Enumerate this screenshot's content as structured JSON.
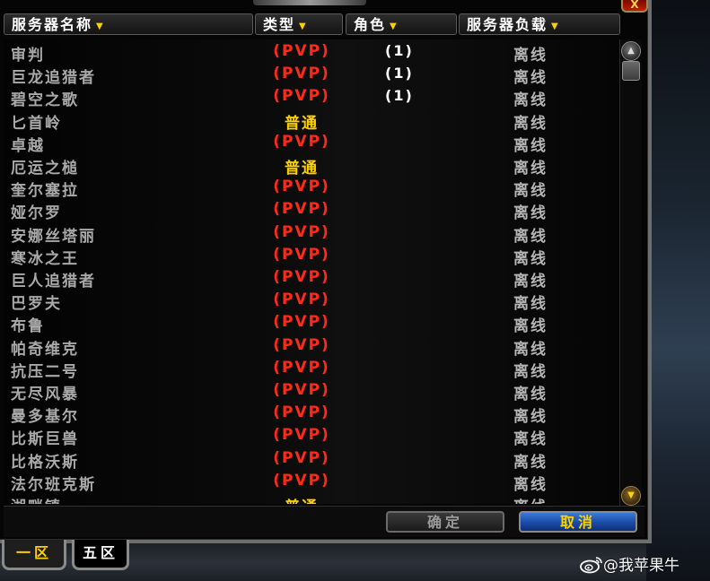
{
  "header": {
    "col_name": "服务器名称",
    "col_type": "类型",
    "col_char": "角色",
    "col_load": "服务器负载"
  },
  "colors": {
    "pvp": "#ff2a1a",
    "normal": "#ffd100",
    "accent_blue": "#1a4aa8"
  },
  "servers": [
    {
      "name": "审判",
      "type": "(PVP)",
      "type_kind": "pvp",
      "chars": "(1)",
      "load": "离线"
    },
    {
      "name": "巨龙追猎者",
      "type": "(PVP)",
      "type_kind": "pvp",
      "chars": "(1)",
      "load": "离线"
    },
    {
      "name": "碧空之歌",
      "type": "(PVP)",
      "type_kind": "pvp",
      "chars": "(1)",
      "load": "离线"
    },
    {
      "name": "匕首岭",
      "type": "普通",
      "type_kind": "normal",
      "chars": "",
      "load": "离线"
    },
    {
      "name": "卓越",
      "type": "(PVP)",
      "type_kind": "pvp",
      "chars": "",
      "load": "离线"
    },
    {
      "name": "厄运之槌",
      "type": "普通",
      "type_kind": "normal",
      "chars": "",
      "load": "离线"
    },
    {
      "name": "奎尔塞拉",
      "type": "(PVP)",
      "type_kind": "pvp",
      "chars": "",
      "load": "离线"
    },
    {
      "name": "娅尔罗",
      "type": "(PVP)",
      "type_kind": "pvp",
      "chars": "",
      "load": "离线"
    },
    {
      "name": "安娜丝塔丽",
      "type": "(PVP)",
      "type_kind": "pvp",
      "chars": "",
      "load": "离线"
    },
    {
      "name": "寒冰之王",
      "type": "(PVP)",
      "type_kind": "pvp",
      "chars": "",
      "load": "离线"
    },
    {
      "name": "巨人追猎者",
      "type": "(PVP)",
      "type_kind": "pvp",
      "chars": "",
      "load": "离线"
    },
    {
      "name": "巴罗夫",
      "type": "(PVP)",
      "type_kind": "pvp",
      "chars": "",
      "load": "离线"
    },
    {
      "name": "布鲁",
      "type": "(PVP)",
      "type_kind": "pvp",
      "chars": "",
      "load": "离线"
    },
    {
      "name": "帕奇维克",
      "type": "(PVP)",
      "type_kind": "pvp",
      "chars": "",
      "load": "离线"
    },
    {
      "name": "抗压二号",
      "type": "(PVP)",
      "type_kind": "pvp",
      "chars": "",
      "load": "离线"
    },
    {
      "name": "无尽风暴",
      "type": "(PVP)",
      "type_kind": "pvp",
      "chars": "",
      "load": "离线"
    },
    {
      "name": "曼多基尔",
      "type": "(PVP)",
      "type_kind": "pvp",
      "chars": "",
      "load": "离线"
    },
    {
      "name": "比斯巨兽",
      "type": "(PVP)",
      "type_kind": "pvp",
      "chars": "",
      "load": "离线"
    },
    {
      "name": "比格沃斯",
      "type": "(PVP)",
      "type_kind": "pvp",
      "chars": "",
      "load": "离线"
    },
    {
      "name": "法尔班克斯",
      "type": "(PVP)",
      "type_kind": "pvp",
      "chars": "",
      "load": "离线"
    },
    {
      "name": "湖畔镇",
      "type": "普通",
      "type_kind": "normal",
      "chars": "",
      "load": "离线"
    }
  ],
  "buttons": {
    "ok": "确定",
    "cancel": "取消",
    "close": "X"
  },
  "tabs": [
    {
      "label": "一区"
    },
    {
      "label": "五区"
    }
  ],
  "scroll": {
    "up_icon": "scroll-up-arrow",
    "down_icon": "scroll-down-arrow"
  },
  "watermark": {
    "text": "@我苹果牛",
    "icon": "weibo-logo"
  }
}
